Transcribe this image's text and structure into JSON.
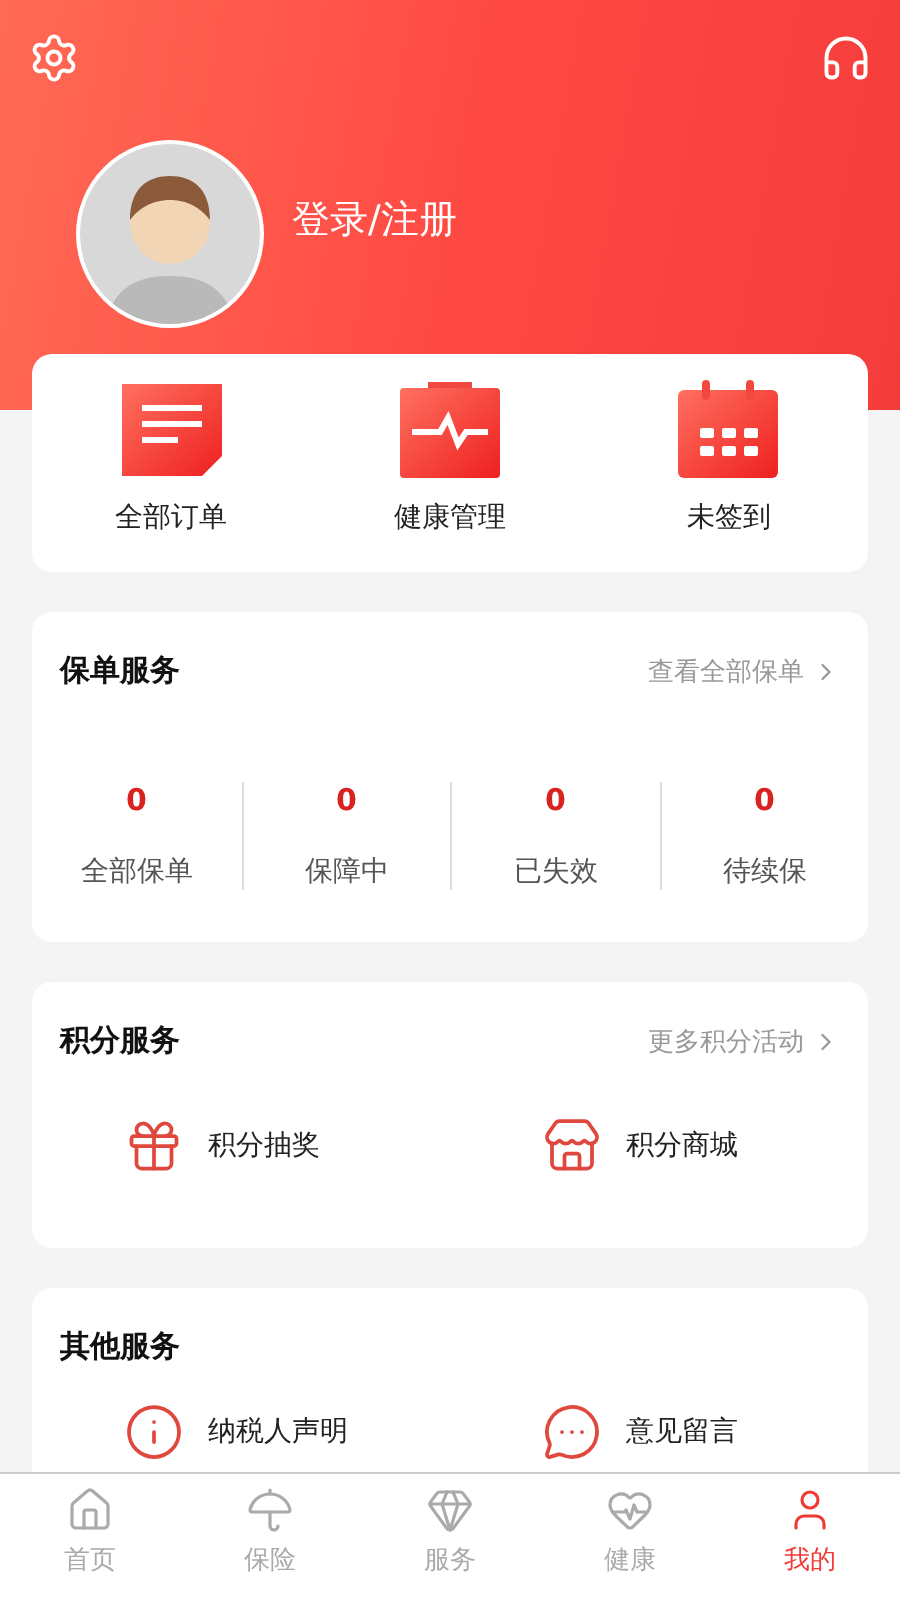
{
  "header": {
    "login_label": "登录/注册"
  },
  "quick_actions": [
    {
      "kind": "orders",
      "label": "全部订单"
    },
    {
      "kind": "health",
      "label": "健康管理"
    },
    {
      "kind": "calendar",
      "label": "未签到"
    }
  ],
  "policy_service": {
    "title": "保单服务",
    "link": "查看全部保单",
    "stats": [
      {
        "value": "0",
        "label": "全部保单"
      },
      {
        "value": "0",
        "label": "保障中"
      },
      {
        "value": "0",
        "label": "已失效"
      },
      {
        "value": "0",
        "label": "待续保"
      }
    ]
  },
  "points_service": {
    "title": "积分服务",
    "link": "更多积分活动",
    "items": [
      {
        "kind": "gift",
        "label": "积分抽奖"
      },
      {
        "kind": "store",
        "label": "积分商城"
      }
    ]
  },
  "other_service": {
    "title": "其他服务",
    "items": [
      {
        "kind": "info",
        "label": "纳税人声明"
      },
      {
        "kind": "message",
        "label": "意见留言"
      }
    ]
  },
  "tab_bar": [
    {
      "kind": "home",
      "label": "首页",
      "selected": false
    },
    {
      "kind": "insurance",
      "label": "保险",
      "selected": false
    },
    {
      "kind": "service",
      "label": "服务",
      "selected": false
    },
    {
      "kind": "health",
      "label": "健康",
      "selected": false
    },
    {
      "kind": "me",
      "label": "我的",
      "selected": true
    }
  ]
}
